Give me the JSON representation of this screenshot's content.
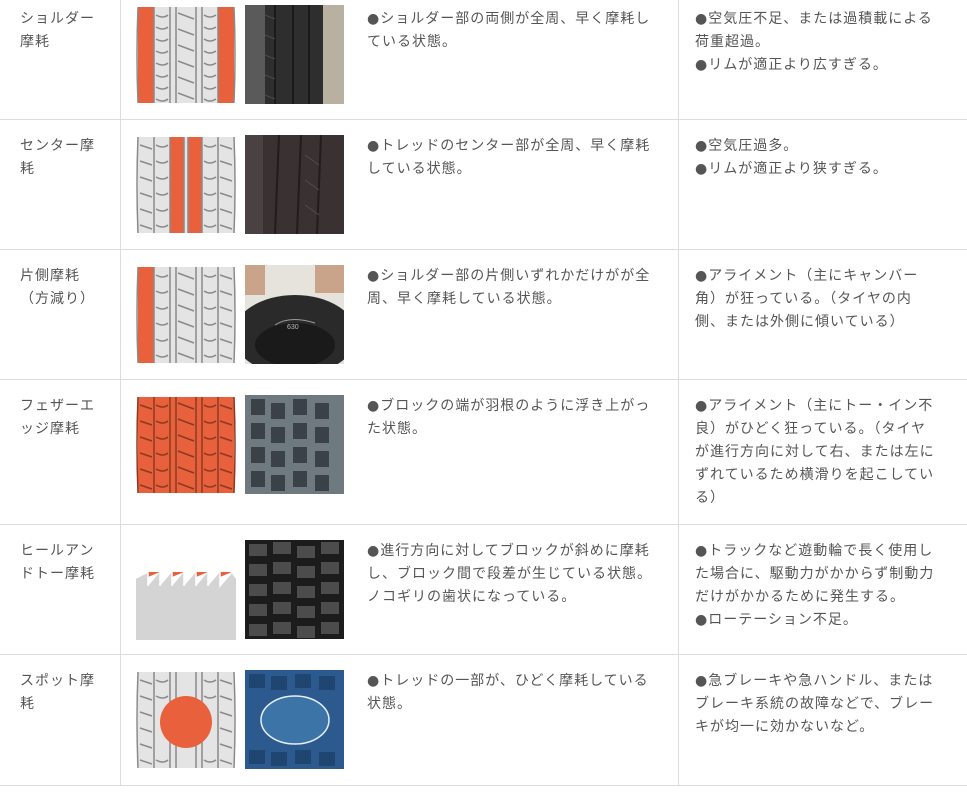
{
  "colors": {
    "border": "#dcdcdc",
    "text": "#555555",
    "wear_orange": "#e8603c",
    "tread_gray": "#c8c8c8"
  },
  "rows": [
    {
      "name": "ショルダー摩耗",
      "name_lines": [
        "ショルダー",
        "摩耗"
      ],
      "diagram_icon": "shoulder-wear-diagram-icon",
      "photo_icon": "shoulder-wear-tire-photo",
      "description": "●ショルダー部の両側が全周、早く摩耗している状態。",
      "description_lines": [
        "●ショルダー部の両側が全周、早く摩耗し",
        "ている状態。"
      ],
      "cause_lines": [
        "●空気圧不足、または過積載による",
        "荷重超過。",
        "●リムが適正より広すぎる。"
      ]
    },
    {
      "name": "センター摩耗",
      "name_lines": [
        "センター摩",
        "耗"
      ],
      "diagram_icon": "center-wear-diagram-icon",
      "photo_icon": "center-wear-tire-photo",
      "description_lines": [
        "●トレッドのセンター部が全周、早く摩耗",
        "している状態。"
      ],
      "cause_lines": [
        "●空気圧過多。",
        "●リムが適正より狭すぎる。"
      ]
    },
    {
      "name": "片側摩耗（方減り）",
      "name_lines": [
        "片側摩耗",
        "（方減り）"
      ],
      "diagram_icon": "one-side-wear-diagram-icon",
      "photo_icon": "one-side-wear-tire-photo",
      "description_lines": [
        "●ショルダー部の片側いずれかだけがが全",
        "周、早く摩耗している状態。"
      ],
      "cause_lines": [
        "●アライメント（主にキャンバー",
        "角）が狂っている。（タイヤの内",
        "側、または外側に傾いている）"
      ]
    },
    {
      "name": "フェザーエッジ摩耗",
      "name_lines": [
        "フェザーエ",
        "ッジ摩耗"
      ],
      "diagram_icon": "feather-edge-diagram-icon",
      "photo_icon": "feather-edge-tire-photo",
      "description_lines": [
        "●ブロックの端が羽根のように浮き上がっ",
        "た状態。"
      ],
      "cause_lines": [
        "●アライメント（主にトー・イン不",
        "良）がひどく狂っている。（タイヤ",
        "が進行方向に対して右、または左に",
        "ずれているため横滑りを起こしてい",
        "る）"
      ]
    },
    {
      "name": "ヒールアンドトー摩耗",
      "name_lines": [
        "ヒールアン",
        "ドトー摩耗"
      ],
      "diagram_icon": "heel-toe-diagram-icon",
      "photo_icon": "heel-toe-tire-photo",
      "description_lines": [
        "●進行方向に対してブロックが斜めに摩耗",
        "し、ブロック間で段差が生じている状態。",
        "ノコギリの歯状になっている。"
      ],
      "cause_lines": [
        "●トラックなど遊動輪で長く使用し",
        "た場合に、駆動力がかからず制動力",
        "だけがかかるために発生する。",
        "●ローテーション不足。"
      ]
    },
    {
      "name": "スポット摩耗",
      "name_lines": [
        "スポット摩",
        "耗"
      ],
      "diagram_icon": "spot-wear-diagram-icon",
      "photo_icon": "spot-wear-tire-photo",
      "description_lines": [
        "●トレッドの一部が、ひどく摩耗している",
        "状態。"
      ],
      "cause_lines": [
        "●急ブレーキや急ハンドル、または",
        "ブレーキ系統の故障などで、ブレー",
        "キが均一に効かないなど。"
      ]
    }
  ]
}
